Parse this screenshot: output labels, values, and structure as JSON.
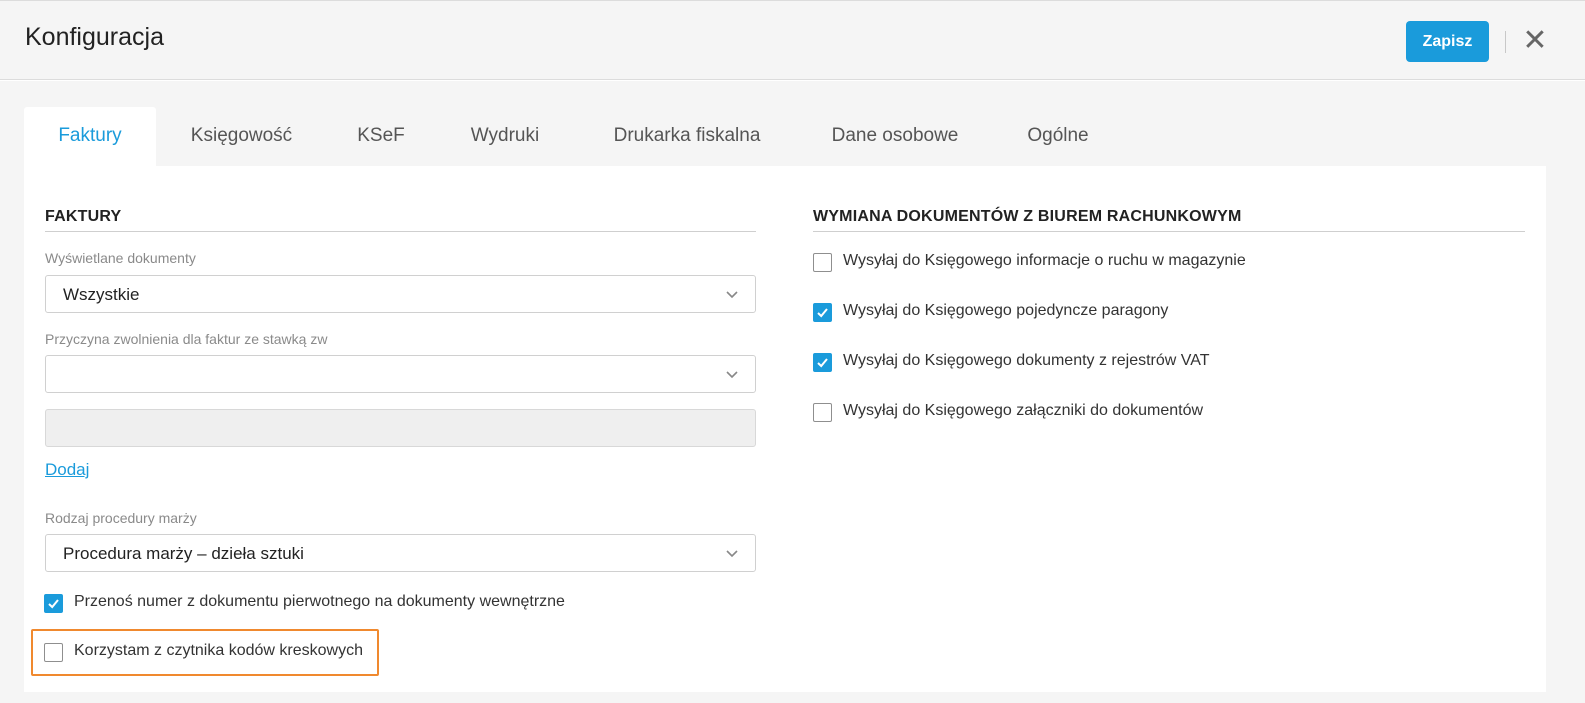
{
  "header": {
    "title": "Konfiguracja",
    "save_label": "Zapisz",
    "close_icon": "close-icon"
  },
  "tabs": [
    {
      "label": "Faktury",
      "active": true
    },
    {
      "label": "Księgowość",
      "active": false
    },
    {
      "label": "KSeF",
      "active": false
    },
    {
      "label": "Wydruki",
      "active": false
    },
    {
      "label": "Drukarka fiskalna",
      "active": false
    },
    {
      "label": "Dane osobowe",
      "active": false
    },
    {
      "label": "Ogólne",
      "active": false
    }
  ],
  "invoices": {
    "section_title": "FAKTURY",
    "displayed_docs": {
      "label": "Wyświetlane dokumenty",
      "value": "Wszystkie"
    },
    "exemption_reason": {
      "label": "Przyczyna zwolnienia dla faktur ze stawką zw",
      "value": "",
      "text_value": ""
    },
    "add_link": "Dodaj",
    "margin_procedure": {
      "label": "Rodzaj procedury marży",
      "value": "Procedura marży – dzieła sztuki"
    },
    "checkboxes": [
      {
        "label": "Przenoś numer z dokumentu pierwotnego na dokumenty wewnętrzne",
        "checked": true
      },
      {
        "label": "Korzystam z czytnika kodów kreskowych",
        "checked": false,
        "highlighted": true
      }
    ]
  },
  "exchange": {
    "section_title": "WYMIANA DOKUMENTÓW Z BIUREM RACHUNKOWYM",
    "checkboxes": [
      {
        "label": "Wysyłaj do Księgowego informacje o ruchu w magazynie",
        "checked": false
      },
      {
        "label": "Wysyłaj do Księgowego pojedyncze paragony",
        "checked": true
      },
      {
        "label": "Wysyłaj do Księgowego dokumenty z rejestrów VAT",
        "checked": true
      },
      {
        "label": "Wysyłaj do Księgowego załączniki do dokumentów",
        "checked": false
      }
    ]
  },
  "colors": {
    "accent": "#1a9bdb",
    "highlight": "#f0892e"
  }
}
